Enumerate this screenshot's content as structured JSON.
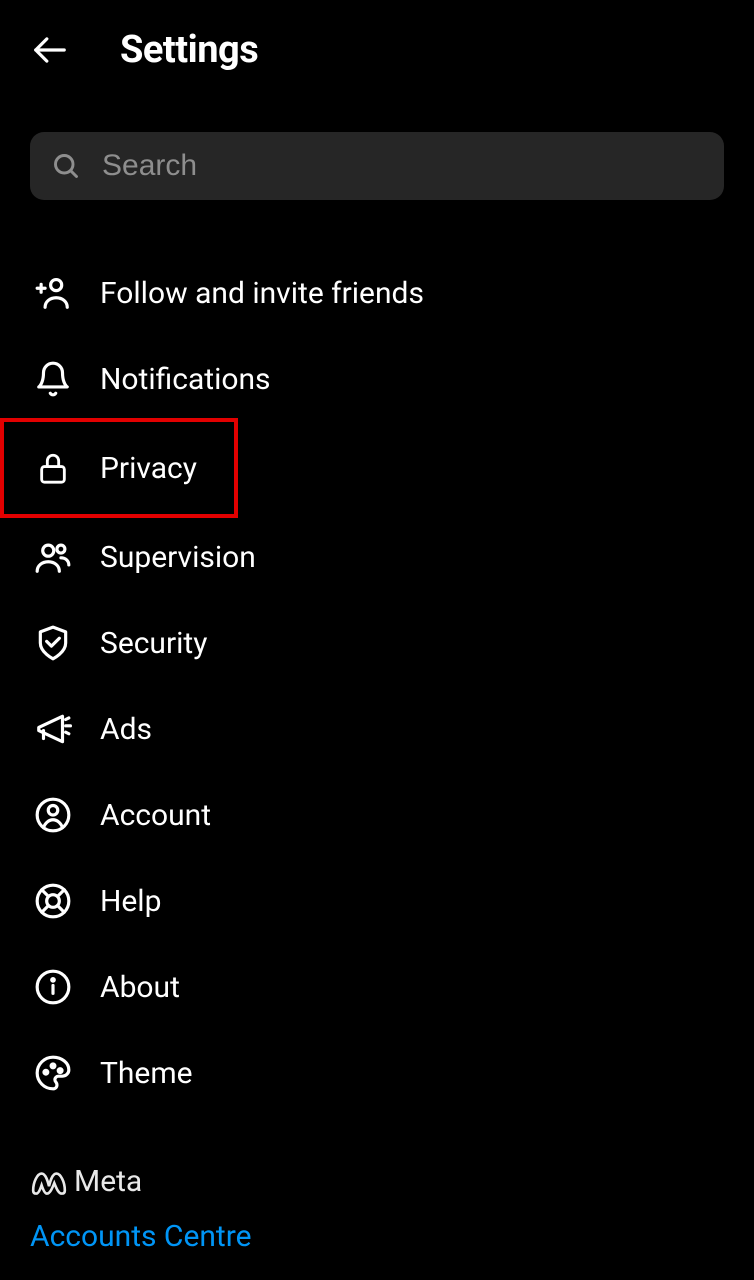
{
  "header": {
    "title": "Settings"
  },
  "search": {
    "placeholder": "Search"
  },
  "menu": {
    "items": [
      {
        "label": "Follow and invite friends",
        "icon": "person-add"
      },
      {
        "label": "Notifications",
        "icon": "bell"
      },
      {
        "label": "Privacy",
        "icon": "lock",
        "highlighted": true
      },
      {
        "label": "Supervision",
        "icon": "people"
      },
      {
        "label": "Security",
        "icon": "shield-check"
      },
      {
        "label": "Ads",
        "icon": "megaphone"
      },
      {
        "label": "Account",
        "icon": "user-circle"
      },
      {
        "label": "Help",
        "icon": "lifebuoy"
      },
      {
        "label": "About",
        "icon": "info"
      },
      {
        "label": "Theme",
        "icon": "palette"
      }
    ]
  },
  "footer": {
    "brand": "Meta",
    "link": "Accounts Centre"
  }
}
